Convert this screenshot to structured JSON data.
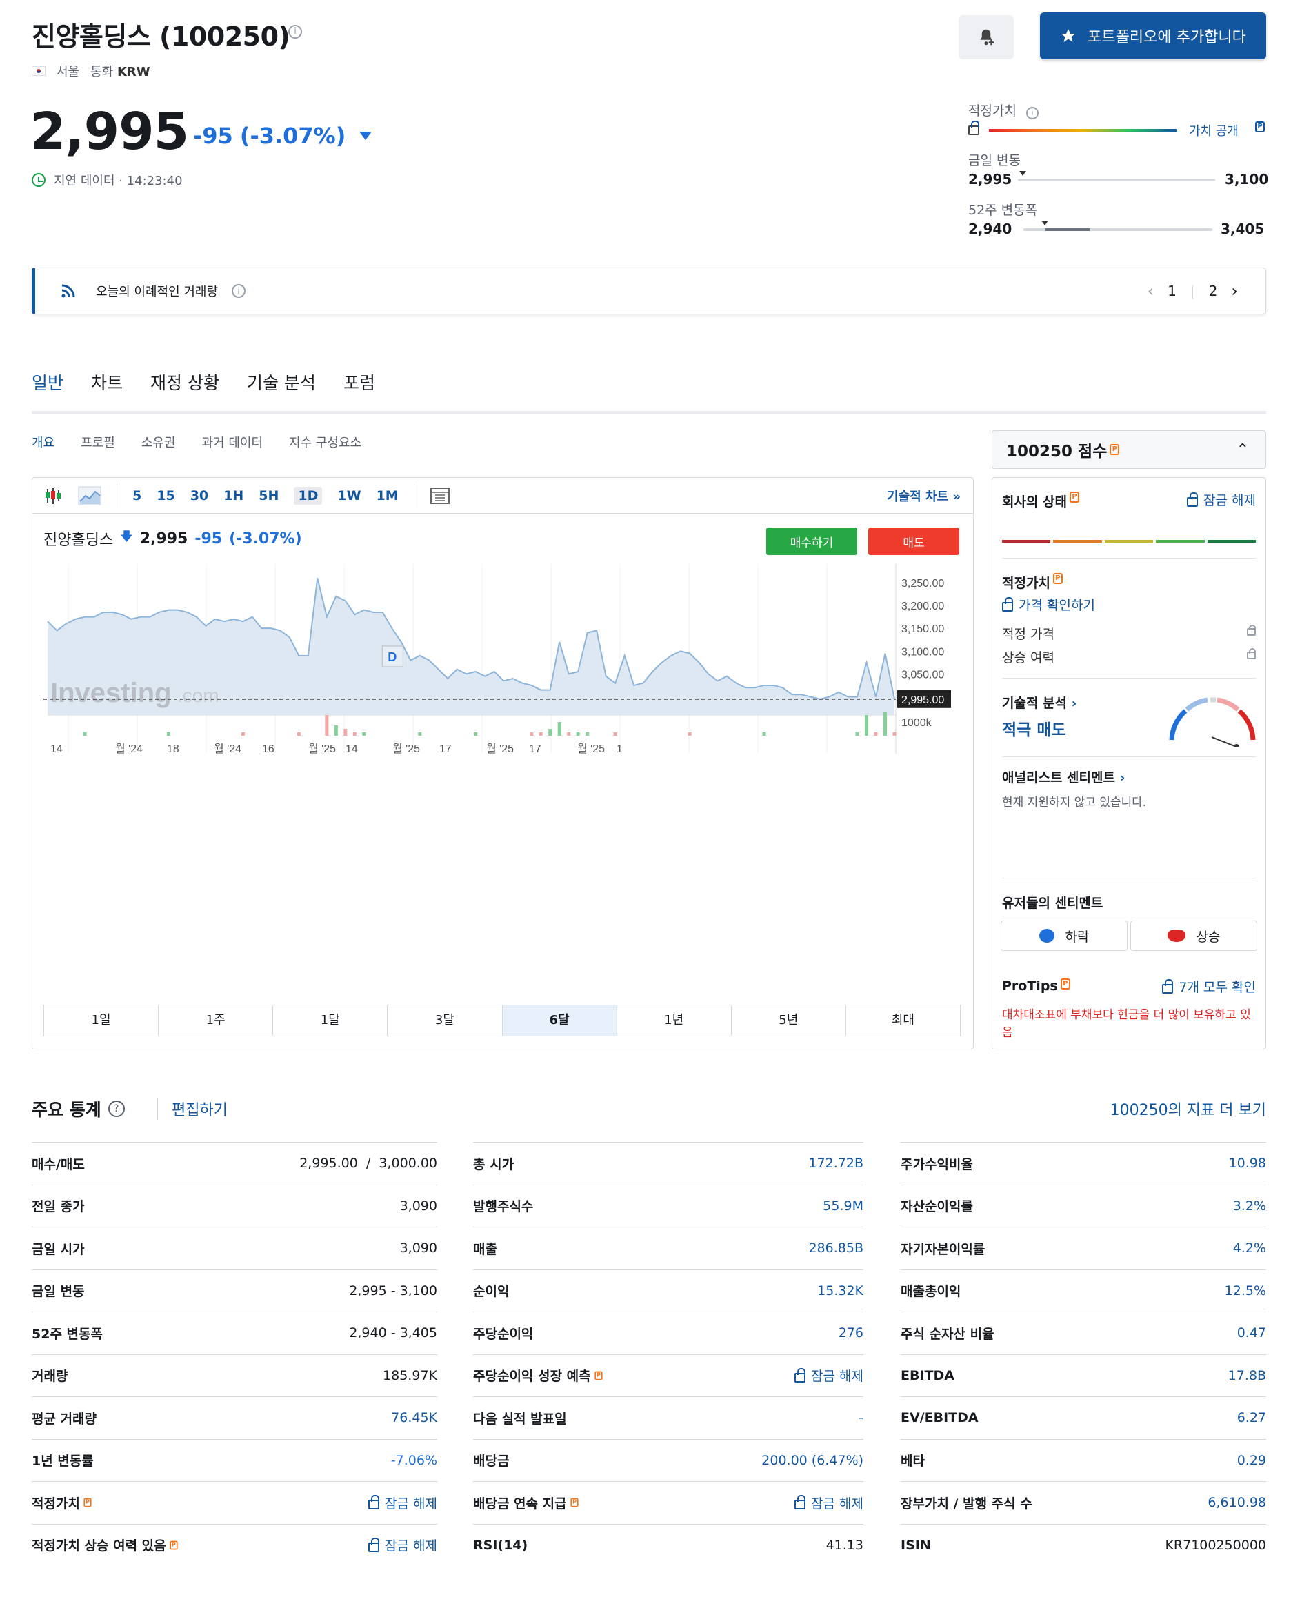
{
  "header": {
    "title": "진양홀딩스 (100250)",
    "exchange": "서울",
    "currency_label": "통화",
    "currency": "KRW",
    "portfolio_button": "포트폴리오에 추가합니다"
  },
  "quote": {
    "price": "2,995",
    "change": "-95",
    "change_pct": "(-3.07%)",
    "delay_text": "지연 데이터 · 14:23:40"
  },
  "ranges": {
    "fair_value_label": "적정가치",
    "fair_value_link": "가치 공개",
    "day_label": "금일 변동",
    "day_low": "2,995",
    "day_high": "3,100",
    "week52_label": "52주 변동폭",
    "week52_low": "2,940",
    "week52_high": "3,405"
  },
  "banner": {
    "text": "오늘의 이례적인 거래량",
    "page1": "1",
    "page2": "2"
  },
  "tabs": [
    "일반",
    "차트",
    "재정 상황",
    "기술 분석",
    "포럼"
  ],
  "subtabs": [
    "개요",
    "프로필",
    "소유권",
    "과거 데이터",
    "지수 구성요소"
  ],
  "chart_toolbar": {
    "intervals": [
      "5",
      "15",
      "30",
      "1H",
      "5H",
      "1D",
      "1W",
      "1M"
    ],
    "selected": "1D",
    "tech_chart_link": "기술적 차트 »"
  },
  "chart": {
    "name": "진양홀딩스",
    "price": "2,995",
    "change": "-95",
    "change_pct": "(-3.07%)",
    "buy": "매수하기",
    "sell": "매도",
    "watermark": "Investing",
    "watermark_suffix": ".com",
    "marker": "D",
    "volume_label": "1000k",
    "last_price_label": "2,995.00",
    "ranges": [
      "1일",
      "1주",
      "1달",
      "3달",
      "6달",
      "1년",
      "5년",
      "최대"
    ],
    "selected_range": "6달"
  },
  "chart_data": {
    "type": "area",
    "y_ticks": [
      "3,250.00",
      "3,200.00",
      "3,150.00",
      "3,100.00",
      "3,050.00"
    ],
    "ylim": [
      2960,
      3280
    ],
    "x_ticks": [
      "14",
      "월 '24",
      "18",
      "월 '24",
      "16",
      "월 '25",
      "14",
      "월 '25",
      "17",
      "월 '25",
      "17",
      "월 '25",
      "1"
    ],
    "values": [
      3165,
      3145,
      3160,
      3170,
      3175,
      3175,
      3185,
      3185,
      3180,
      3170,
      3175,
      3175,
      3185,
      3190,
      3190,
      3185,
      3175,
      3155,
      3170,
      3165,
      3170,
      3165,
      3175,
      3150,
      3150,
      3145,
      3130,
      3090,
      3090,
      3260,
      3175,
      3220,
      3210,
      3180,
      3190,
      3185,
      3185,
      3150,
      3120,
      3080,
      3090,
      3080,
      3060,
      3040,
      3060,
      3050,
      3055,
      3045,
      3055,
      3035,
      3040,
      3030,
      3025,
      3015,
      3015,
      3120,
      3050,
      3055,
      3140,
      3145,
      3045,
      3030,
      3090,
      3025,
      3030,
      3055,
      3075,
      3090,
      3100,
      3095,
      3075,
      3050,
      3035,
      3045,
      3030,
      3020,
      3020,
      3025,
      3025,
      3020,
      3005,
      3005,
      3000,
      2995,
      3000,
      3010,
      3000,
      3000,
      3075,
      3000,
      3095,
      2995
    ],
    "last": 2995,
    "volume": [
      0,
      0,
      0,
      0,
      1,
      0,
      0,
      0,
      0,
      0,
      0,
      0,
      0,
      1,
      0,
      0,
      0,
      0,
      0,
      0,
      0,
      1,
      0,
      0,
      0,
      0,
      0,
      1,
      0,
      0,
      6,
      3,
      2,
      1,
      1,
      0,
      0,
      0,
      0,
      0,
      1,
      0,
      0,
      0,
      0,
      0,
      1,
      0,
      0,
      0,
      0,
      0,
      1,
      1,
      2,
      4,
      1,
      1,
      1,
      0,
      0,
      1,
      0,
      0,
      0,
      0,
      0,
      0,
      0,
      1,
      0,
      0,
      0,
      0,
      0,
      0,
      0,
      1,
      0,
      0,
      0,
      0,
      0,
      0,
      0,
      0,
      0,
      1,
      6,
      1,
      7,
      1
    ]
  },
  "score": {
    "title": "100250 점수",
    "health": "회사의 상태",
    "unlock": "잠금 해제",
    "fair_value": "적정가치",
    "check_price": "가격 확인하기",
    "fair_price": "적정 가격",
    "upside": "상승 여력",
    "tech": "기술적 분석",
    "tech_value": "적극 매도",
    "analyst": "애널리스트 센티멘트",
    "analyst_note": "현재 지원하지 않고 있습니다.",
    "users": "유저들의 센티멘트",
    "bear": "하락",
    "bull": "상승",
    "protips": "ProTips",
    "protips_all": "7개 모두 확인",
    "protip_text": "대차대조표에 부채보다 현금을 더 많이 보유하고 있음",
    "health_colors": [
      "#c0262d",
      "#e07b24",
      "#c9b52a",
      "#4caf50",
      "#1b7a3d"
    ]
  },
  "stats": {
    "title": "주요 통계",
    "edit": "편집하기",
    "more": "100250의 지표 더 보기",
    "col1": [
      {
        "k": "매수/매도",
        "v": "2,995.00  /  3,000.00",
        "s": "plain"
      },
      {
        "k": "전일 종가",
        "v": "3,090",
        "s": "plain"
      },
      {
        "k": "금일 시가",
        "v": "3,090",
        "s": "plain"
      },
      {
        "k": "금일 변동",
        "v": "2,995 - 3,100",
        "s": "plain"
      },
      {
        "k": "52주 변동폭",
        "v": "2,940 - 3,405",
        "s": "plain"
      },
      {
        "k": "거래량",
        "v": "185.97K",
        "s": "plain"
      },
      {
        "k": "평균 거래량",
        "v": "76.45K",
        "s": "blue"
      },
      {
        "k": "1년 변동률",
        "v": "-7.06%",
        "s": "neg"
      },
      {
        "k": "적정가치",
        "v": "잠금 해제",
        "s": "lock"
      },
      {
        "k": "적정가치 상승 여력 있음",
        "v": "잠금 해제",
        "s": "lock"
      }
    ],
    "col2": [
      {
        "k": "총 시가",
        "v": "172.72B",
        "s": "blue"
      },
      {
        "k": "발행주식수",
        "v": "55.9M",
        "s": "blue"
      },
      {
        "k": "매출",
        "v": "286.85B",
        "s": "blue"
      },
      {
        "k": "순이익",
        "v": "15.32K",
        "s": "blue"
      },
      {
        "k": "주당순이익",
        "v": "276",
        "s": "blue"
      },
      {
        "k": "주당순이익 성장 예측",
        "v": "잠금 해제",
        "s": "lock"
      },
      {
        "k": "다음 실적 발표일",
        "v": "-",
        "s": "blue"
      },
      {
        "k": "배당금",
        "v": "200.00 (6.47%)",
        "s": "blue"
      },
      {
        "k": "배당금 연속 지급",
        "v": "잠금 해제",
        "s": "lock"
      },
      {
        "k": "RSI(14)",
        "v": "41.13",
        "s": "plain"
      }
    ],
    "col3": [
      {
        "k": "주가수익비율",
        "v": "10.98",
        "s": "blue"
      },
      {
        "k": "자산순이익률",
        "v": "3.2%",
        "s": "blue"
      },
      {
        "k": "자기자본이익률",
        "v": "4.2%",
        "s": "blue"
      },
      {
        "k": "매출총이익",
        "v": "12.5%",
        "s": "blue"
      },
      {
        "k": "주식 순자산 비율",
        "v": "0.47",
        "s": "blue"
      },
      {
        "k": "EBITDA",
        "v": "17.8B",
        "s": "blue"
      },
      {
        "k": "EV/EBITDA",
        "v": "6.27",
        "s": "blue"
      },
      {
        "k": "베타",
        "v": "0.29",
        "s": "blue"
      },
      {
        "k": "장부가치 / 발행 주식 수",
        "v": "6,610.98",
        "s": "blue"
      },
      {
        "k": "ISIN",
        "v": "KR7100250000",
        "s": "plain"
      }
    ]
  }
}
